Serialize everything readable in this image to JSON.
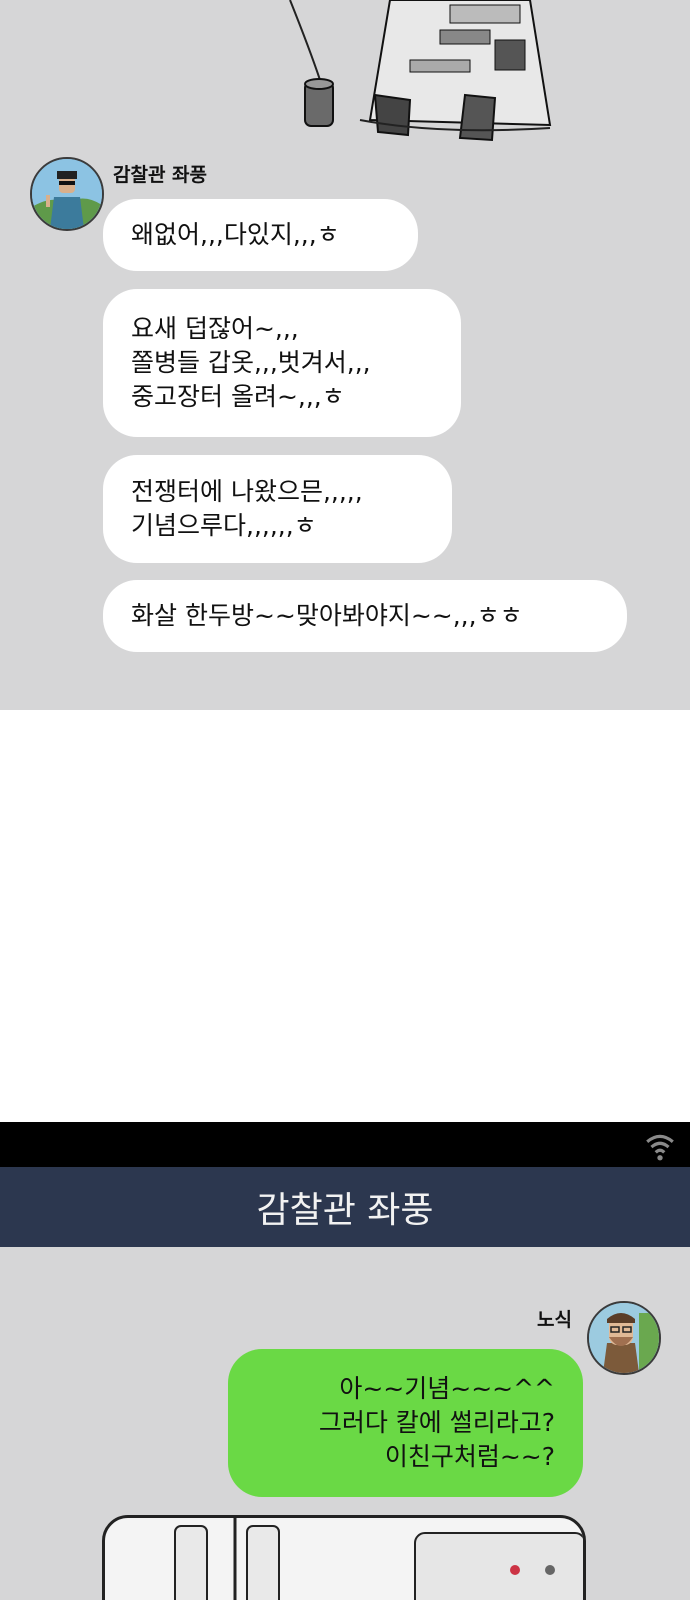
{
  "panel_top": {
    "sender": {
      "name": "감찰관 좌풍"
    },
    "messages": [
      {
        "text": "왜없어,,,다있지,,,ㅎ"
      },
      {
        "text": "요새 덥잖어~,,,\n쫄병들 갑옷,,,벗겨서,,,\n중고장터 올려~,,,ㅎ"
      },
      {
        "text": "전쟁터에 나왔으믄,,,,,\n기념으루다,,,,,,ㅎ"
      },
      {
        "text": "화살 한두방~~맞아봐야지~~,,,ㅎㅎ"
      }
    ]
  },
  "chat_header": {
    "title": "감찰관 좌풍",
    "status_icon": "wifi-icon"
  },
  "panel_bottom": {
    "sender": {
      "name": "노식"
    },
    "messages": [
      {
        "text": "아~~기념~~~^^\n그러다 칼에 썰리라고?\n이친구처럼~~?"
      }
    ]
  },
  "colors": {
    "chat_bg": "#d6d6d7",
    "bubble_other": "#ffffff",
    "bubble_me": "#6ad945",
    "header_bg": "#2c374f"
  }
}
